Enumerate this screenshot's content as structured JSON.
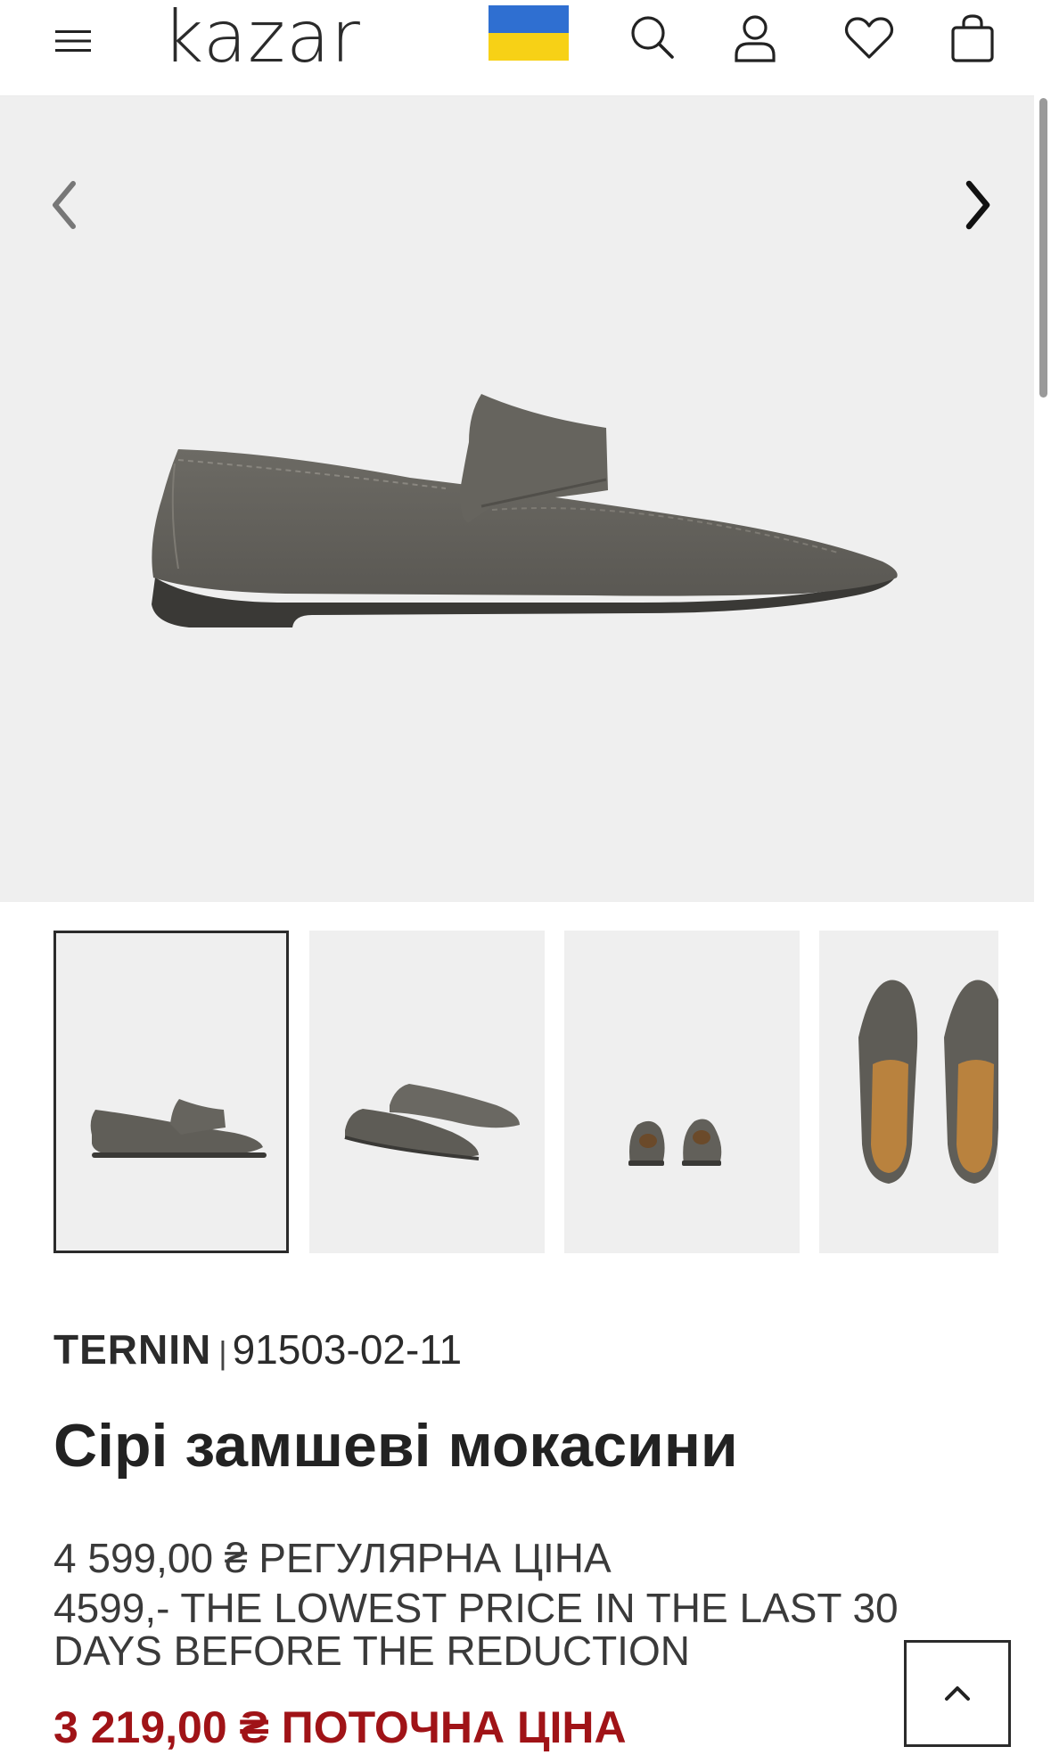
{
  "header": {
    "logo": "kazar",
    "icons": {
      "menu": "menu-icon",
      "flag": "ukraine-flag-icon",
      "search": "search-icon",
      "account": "user-icon",
      "wishlist": "heart-icon",
      "cart": "bag-icon"
    }
  },
  "gallery": {
    "prev_icon": "chevron-left-icon",
    "next_icon": "chevron-right-icon",
    "thumbnail_count": 4,
    "active_thumbnail": 1
  },
  "product": {
    "brand": "TERNIN",
    "separator": "|",
    "sku": "91503-02-11",
    "title": "Сірі замшеві мокасини",
    "regular_price": "4 599,00 ₴ РЕГУЛЯРНА ЦІНА",
    "lowest_price_note": "4599,- THE LOWEST PRICE IN THE LAST 30 DAYS BEFORE THE REDUCTION",
    "current_price": "3 219,00 ₴ ПОТОЧНА ЦІНА"
  },
  "colors": {
    "sale_red": "#a01317",
    "text_dark": "#2b2b2b",
    "image_bg": "#efefef",
    "flag_blue": "#2f6fd1",
    "flag_yellow": "#f7d116"
  },
  "back_to_top_icon": "chevron-up-icon"
}
